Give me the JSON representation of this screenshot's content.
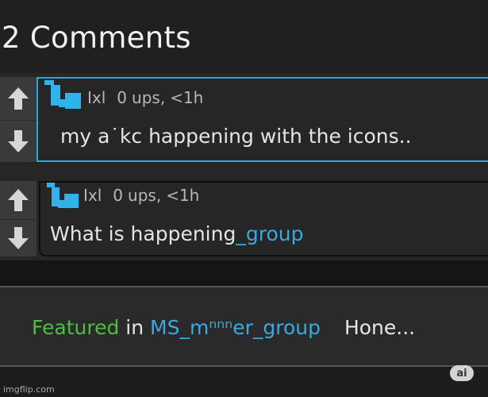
{
  "header": {
    "title": "2 Comments"
  },
  "comments": [
    {
      "username": "Ixl",
      "ups": "0",
      "ups_label": "ups,",
      "time": "<1h",
      "text": "my a˙kc happening with the icons..",
      "highlight": ""
    },
    {
      "username": "Ixl",
      "ups": "0",
      "ups_label": "ups,",
      "time": "<1h",
      "text": "What is happening",
      "highlight": "_group"
    }
  ],
  "featured": {
    "label": "Featured",
    "in_word": "in",
    "stream": "MS_mⁿⁿⁿer_group",
    "next": "Hone..."
  },
  "footer": {
    "watermark": "imgflip.com",
    "badge": "ai"
  },
  "colors": {
    "accent": "#29a8de",
    "featured": "#4fbb45",
    "background": "#1f1f1f"
  },
  "icons": [
    "upvote-arrow-icon",
    "downvote-arrow-icon",
    "user-avatar-icon"
  ]
}
